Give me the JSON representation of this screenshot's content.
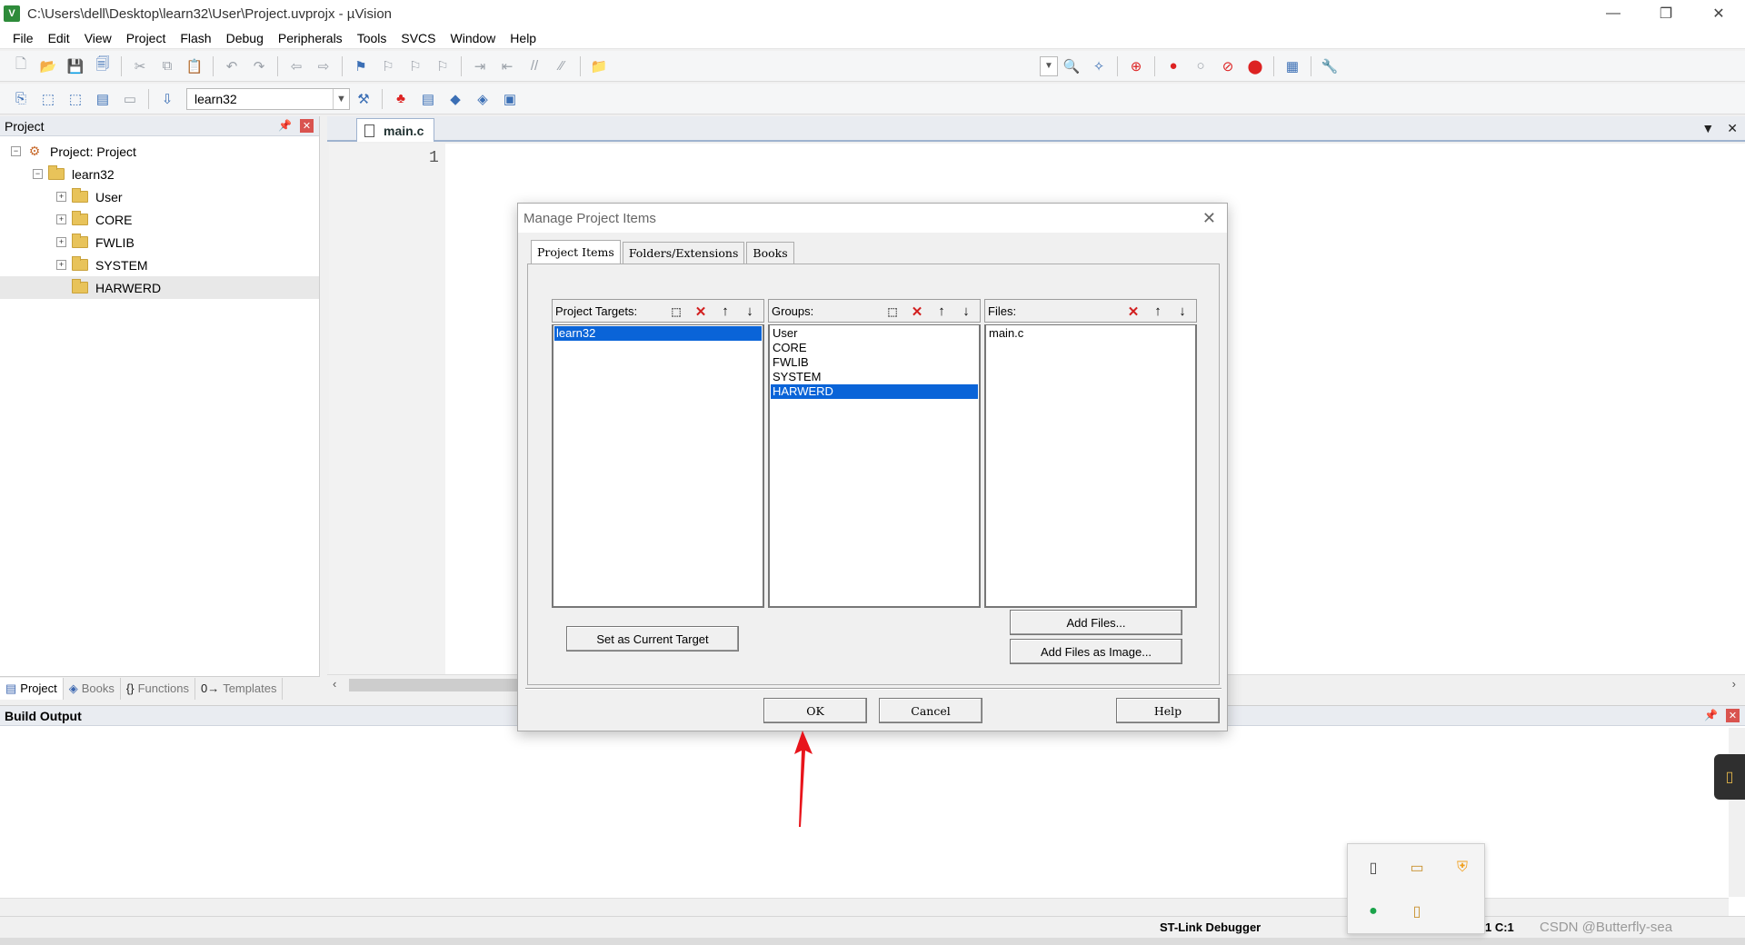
{
  "window": {
    "title": "C:\\Users\\dell\\Desktop\\learn32\\User\\Project.uvprojx - µVision",
    "app_icon_letter": "V",
    "controls": [
      "—",
      "❐",
      "✕"
    ]
  },
  "menu": [
    "File",
    "Edit",
    "View",
    "Project",
    "Flash",
    "Debug",
    "Peripherals",
    "Tools",
    "SVCS",
    "Window",
    "Help"
  ],
  "toolbar2": {
    "target": "learn32"
  },
  "project_panel": {
    "title": "Project",
    "root": "Project: Project",
    "target": "learn32",
    "groups": [
      "User",
      "CORE",
      "FWLIB",
      "SYSTEM",
      "HARWERD"
    ],
    "tabs": [
      "Project",
      "Books",
      "Functions",
      "Templates"
    ]
  },
  "editor": {
    "tab": "main.c",
    "line_number": "1"
  },
  "build_output": {
    "title": "Build Output"
  },
  "status": {
    "debugger": "ST-Link Debugger",
    "position": "1 C:1",
    "watermark": "CSDN @Butterfly-sea"
  },
  "dialog": {
    "title": "Manage Project Items",
    "tabs": [
      "Project Items",
      "Folders/Extensions",
      "Books"
    ],
    "targets_label": "Project Targets:",
    "targets": [
      "learn32"
    ],
    "groups_label": "Groups:",
    "groups": [
      "User",
      "CORE",
      "FWLIB",
      "SYSTEM",
      "HARWERD"
    ],
    "files_label": "Files:",
    "files": [
      "main.c"
    ],
    "set_current": "Set as Current Target",
    "add_files": "Add Files...",
    "add_files_image": "Add Files as Image...",
    "ok": "OK",
    "cancel": "Cancel",
    "help": "Help"
  },
  "colors": {
    "selection": "#0a64d8",
    "annotation": "#e8141b"
  }
}
